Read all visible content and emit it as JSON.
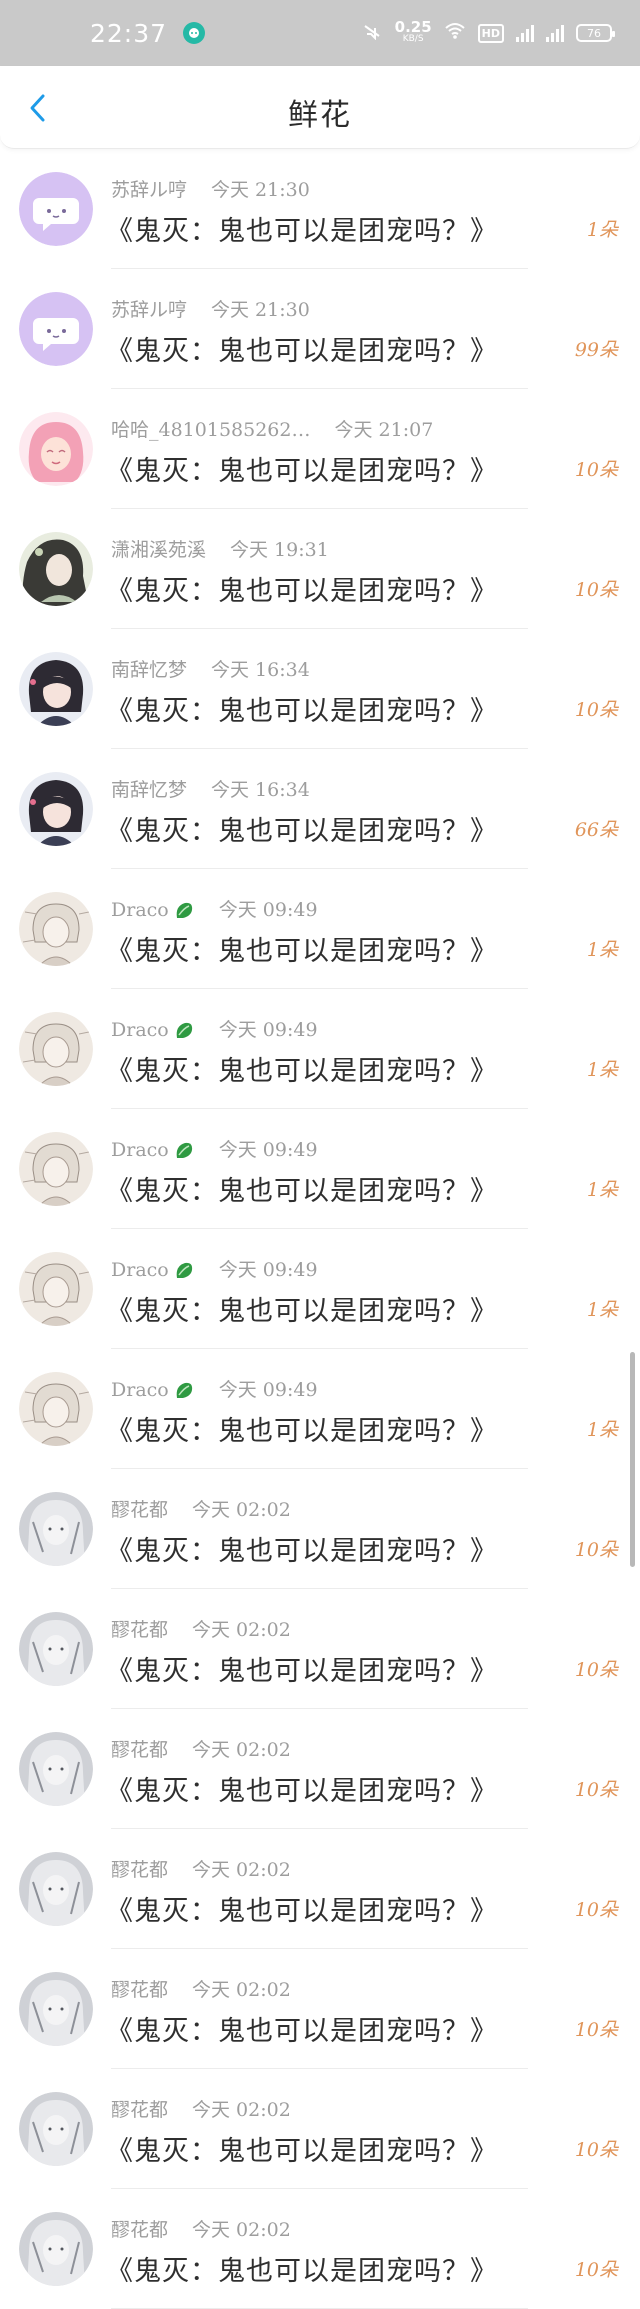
{
  "status_bar": {
    "time": "22:37",
    "net_speed_value": "0.25",
    "net_speed_unit": "KB/S",
    "hd_label": "HD",
    "battery": "76"
  },
  "header": {
    "title": "鲜花"
  },
  "items": [
    {
      "name": "苏辞ル哼",
      "time": "今天 21:30",
      "subject": "《鬼灭：鬼也可以是团宠吗？》",
      "amount": "1朵",
      "avatar": "bubble"
    },
    {
      "name": "苏辞ル哼",
      "time": "今天 21:30",
      "subject": "《鬼灭：鬼也可以是团宠吗？》",
      "amount": "99朵",
      "avatar": "bubble"
    },
    {
      "name": "哈哈_48101585262…",
      "time": "今天 21:07",
      "subject": "《鬼灭：鬼也可以是团宠吗？》",
      "amount": "10朵",
      "avatar": "pink"
    },
    {
      "name": "潇湘溪苑溪",
      "time": "今天 19:31",
      "subject": "《鬼灭：鬼也可以是团宠吗？》",
      "amount": "10朵",
      "avatar": "ink"
    },
    {
      "name": "南辞忆梦",
      "time": "今天 16:34",
      "subject": "《鬼灭：鬼也可以是团宠吗？》",
      "amount": "10朵",
      "avatar": "dark"
    },
    {
      "name": "南辞忆梦",
      "time": "今天 16:34",
      "subject": "《鬼灭：鬼也可以是团宠吗？》",
      "amount": "66朵",
      "avatar": "dark"
    },
    {
      "name": "Draco",
      "time": "今天 09:49",
      "subject": "《鬼灭：鬼也可以是团宠吗？》",
      "amount": "1朵",
      "avatar": "sketch"
    },
    {
      "name": "Draco",
      "time": "今天 09:49",
      "subject": "《鬼灭：鬼也可以是团宠吗？》",
      "amount": "1朵",
      "avatar": "sketch"
    },
    {
      "name": "Draco",
      "time": "今天 09:49",
      "subject": "《鬼灭：鬼也可以是团宠吗？》",
      "amount": "1朵",
      "avatar": "sketch"
    },
    {
      "name": "Draco",
      "time": "今天 09:49",
      "subject": "《鬼灭：鬼也可以是团宠吗？》",
      "amount": "1朵",
      "avatar": "sketch"
    },
    {
      "name": "Draco",
      "time": "今天 09:49",
      "subject": "《鬼灭：鬼也可以是团宠吗？》",
      "amount": "1朵",
      "avatar": "sketch"
    },
    {
      "name": "醪花都",
      "time": "今天 02:02",
      "subject": "《鬼灭：鬼也可以是团宠吗？》",
      "amount": "10朵",
      "avatar": "grey"
    },
    {
      "name": "醪花都",
      "time": "今天 02:02",
      "subject": "《鬼灭：鬼也可以是团宠吗？》",
      "amount": "10朵",
      "avatar": "grey"
    },
    {
      "name": "醪花都",
      "time": "今天 02:02",
      "subject": "《鬼灭：鬼也可以是团宠吗？》",
      "amount": "10朵",
      "avatar": "grey"
    },
    {
      "name": "醪花都",
      "time": "今天 02:02",
      "subject": "《鬼灭：鬼也可以是团宠吗？》",
      "amount": "10朵",
      "avatar": "grey"
    },
    {
      "name": "醪花都",
      "time": "今天 02:02",
      "subject": "《鬼灭：鬼也可以是团宠吗？》",
      "amount": "10朵",
      "avatar": "grey"
    },
    {
      "name": "醪花都",
      "time": "今天 02:02",
      "subject": "《鬼灭：鬼也可以是团宠吗？》",
      "amount": "10朵",
      "avatar": "grey"
    },
    {
      "name": "醪花都",
      "time": "今天 02:02",
      "subject": "《鬼灭：鬼也可以是团宠吗？》",
      "amount": "10朵",
      "avatar": "grey"
    }
  ],
  "colors": {
    "accent_blue": "#1e9be8",
    "amount_orange": "#e0955a",
    "meta_grey": "#9d9d9d",
    "status_bar_bg": "#c9c9c9"
  }
}
